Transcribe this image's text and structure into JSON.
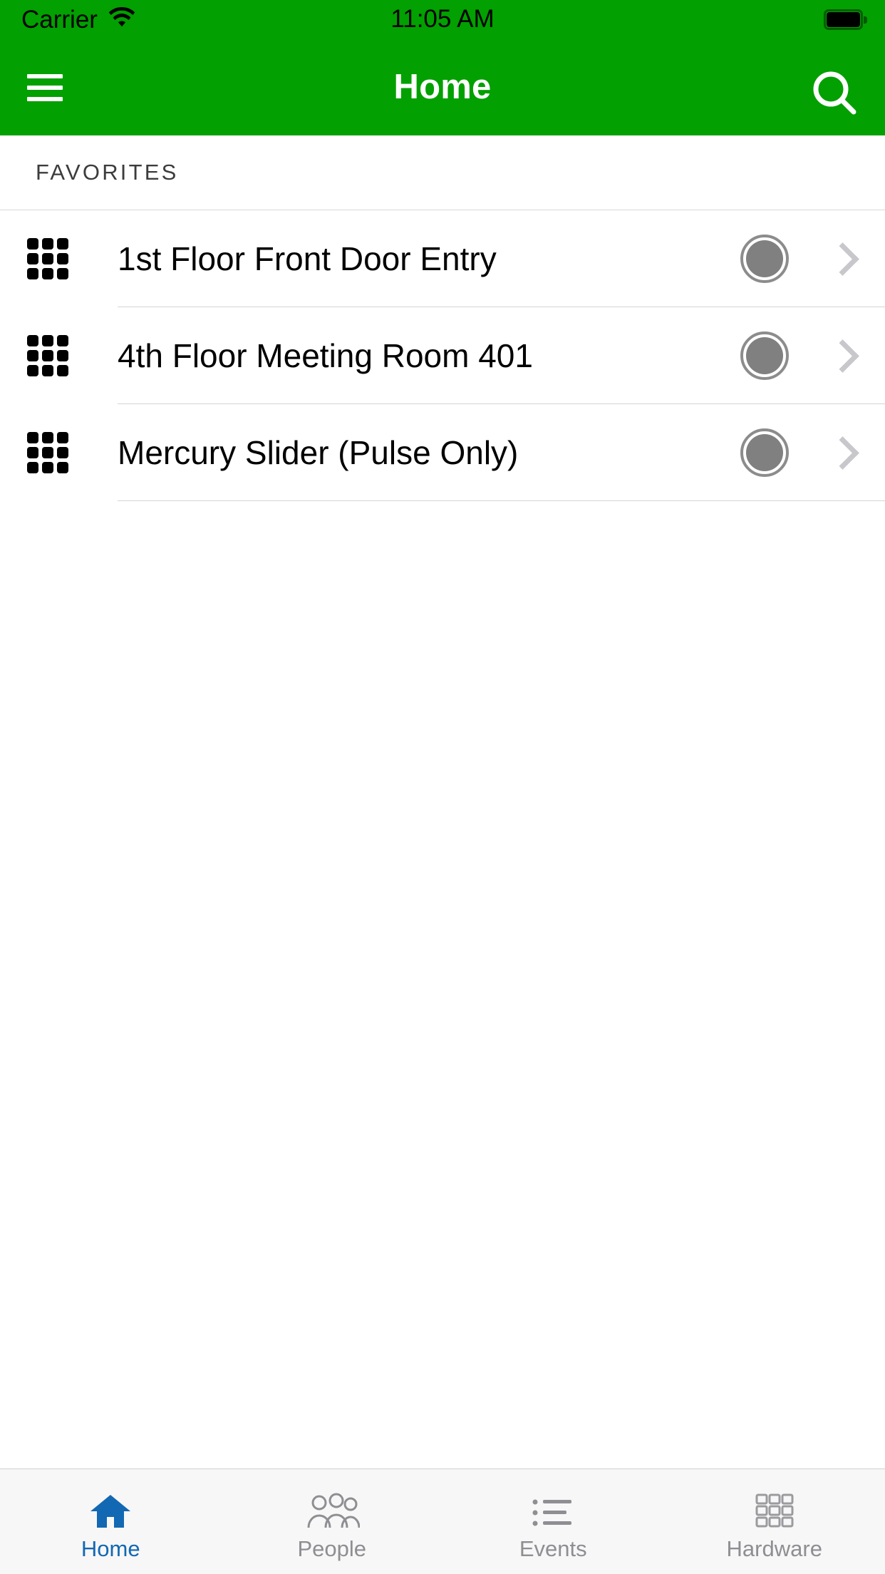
{
  "theme": {
    "brand_green": "#02a000",
    "active_tab_blue": "#1268b3",
    "inactive_gray": "#8e8e93",
    "status_dot_fill": "#808080",
    "chevron_gray": "#c7c7cc"
  },
  "status_bar": {
    "carrier": "Carrier",
    "wifi_icon": "wifi-icon",
    "time": "11:05 AM",
    "battery_icon": "battery-full-icon"
  },
  "nav_bar": {
    "menu_icon": "hamburger-menu-icon",
    "title": "Home",
    "search_icon": "search-icon"
  },
  "main": {
    "section_title": "FAVORITES",
    "rows": [
      {
        "icon": "grid-keypad-icon",
        "label": "1st Floor Front Door Entry",
        "status_icon": "status-circle-icon",
        "chevron": "chevron-right-icon"
      },
      {
        "icon": "grid-keypad-icon",
        "label": "4th Floor Meeting Room 401",
        "status_icon": "status-circle-icon",
        "chevron": "chevron-right-icon"
      },
      {
        "icon": "grid-keypad-icon",
        "label": "Mercury Slider (Pulse Only)",
        "status_icon": "status-circle-icon",
        "chevron": "chevron-right-icon"
      }
    ]
  },
  "tab_bar": {
    "tabs": [
      {
        "label": "Home",
        "icon": "house-icon",
        "active": true
      },
      {
        "label": "People",
        "icon": "people-icon",
        "active": false
      },
      {
        "label": "Events",
        "icon": "list-icon",
        "active": false
      },
      {
        "label": "Hardware",
        "icon": "grid-squares-icon",
        "active": false
      }
    ]
  }
}
